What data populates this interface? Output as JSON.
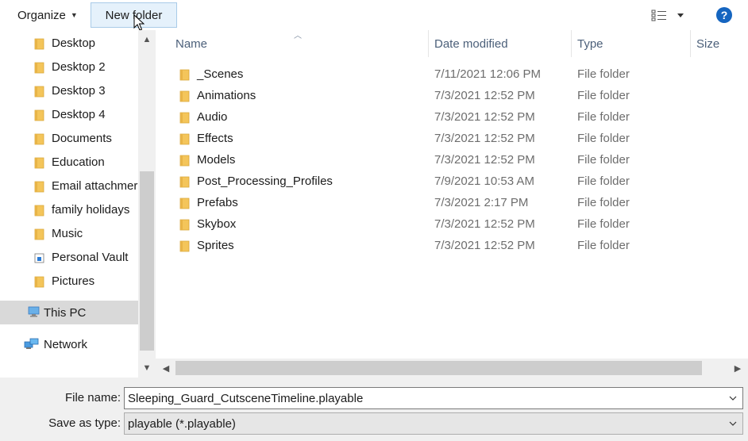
{
  "toolbar": {
    "organize_label": "Organize",
    "new_folder_label": "New folder",
    "help_label": "?"
  },
  "nav": {
    "items": [
      {
        "label": "Desktop"
      },
      {
        "label": "Desktop 2"
      },
      {
        "label": "Desktop 3"
      },
      {
        "label": "Desktop 4"
      },
      {
        "label": "Documents"
      },
      {
        "label": "Education"
      },
      {
        "label": "Email attachmer"
      },
      {
        "label": "family holidays"
      },
      {
        "label": "Music"
      },
      {
        "label": "Personal Vault"
      },
      {
        "label": "Pictures"
      }
    ],
    "this_pc": "This PC",
    "network": "Network"
  },
  "columns": {
    "name": "Name",
    "date": "Date modified",
    "type": "Type",
    "size": "Size"
  },
  "files": [
    {
      "name": "_Scenes",
      "date": "7/11/2021 12:06 PM",
      "type": "File folder"
    },
    {
      "name": "Animations",
      "date": "7/3/2021 12:52 PM",
      "type": "File folder"
    },
    {
      "name": "Audio",
      "date": "7/3/2021 12:52 PM",
      "type": "File folder"
    },
    {
      "name": "Effects",
      "date": "7/3/2021 12:52 PM",
      "type": "File folder"
    },
    {
      "name": "Models",
      "date": "7/3/2021 12:52 PM",
      "type": "File folder"
    },
    {
      "name": "Post_Processing_Profiles",
      "date": "7/9/2021 10:53 AM",
      "type": "File folder"
    },
    {
      "name": "Prefabs",
      "date": "7/3/2021 2:17 PM",
      "type": "File folder"
    },
    {
      "name": "Skybox",
      "date": "7/3/2021 12:52 PM",
      "type": "File folder"
    },
    {
      "name": "Sprites",
      "date": "7/3/2021 12:52 PM",
      "type": "File folder"
    }
  ],
  "save": {
    "file_name_label": "File name:",
    "file_name_value": "Sleeping_Guard_CutsceneTimeline.playable",
    "save_type_label": "Save as type:",
    "save_type_value": "playable (*.playable)"
  },
  "colors": {
    "folder": "#f4c55a",
    "accent": "#1565c0",
    "selection": "#e5f1fb"
  },
  "icons": {
    "folder": "folder-icon",
    "vault": "personal-vault-icon",
    "pc": "this-pc-icon",
    "network": "network-icon",
    "view": "view-options-icon",
    "help": "help-icon"
  }
}
